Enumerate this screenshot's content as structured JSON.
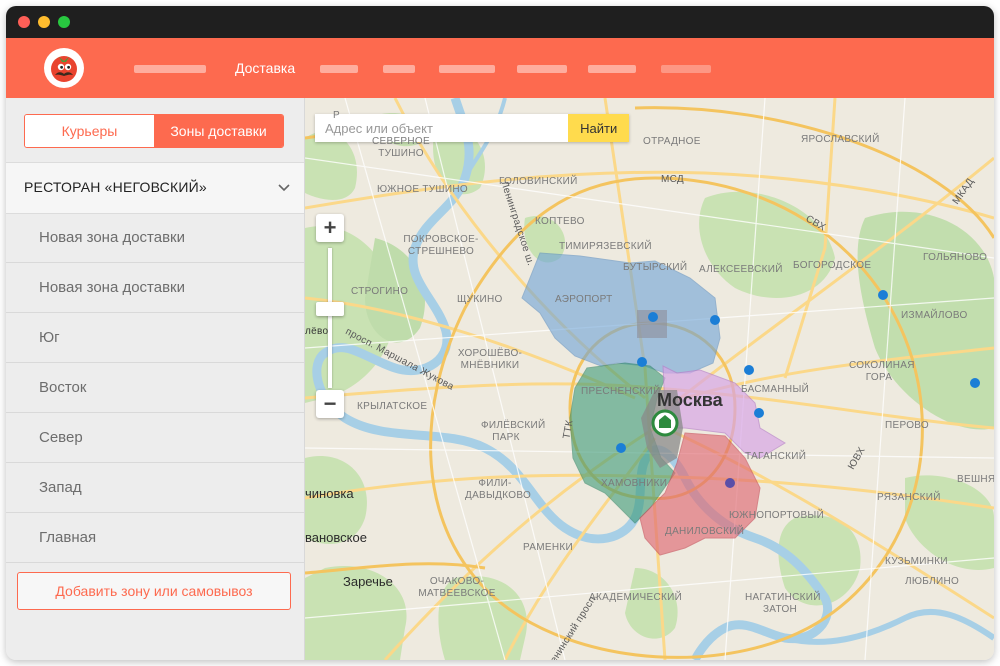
{
  "header": {
    "active_nav": "Доставка"
  },
  "sidebar": {
    "tabs": [
      {
        "label": "Курьеры"
      },
      {
        "label": "Зоны доставки"
      }
    ],
    "restaurant": "РЕСТОРАН «НЕГОВСКИЙ»",
    "zones": [
      {
        "label": "Новая зона доставки"
      },
      {
        "label": "Новая зона доставки"
      },
      {
        "label": "Юг"
      },
      {
        "label": "Восток"
      },
      {
        "label": "Север"
      },
      {
        "label": "Запад"
      },
      {
        "label": "Главная"
      }
    ],
    "add_button": "Добавить зону или самовывоз"
  },
  "map": {
    "search": {
      "placeholder": "Адрес или объект",
      "button": "Найти"
    },
    "zoom_in": "+",
    "zoom_out": "−",
    "city": "Москва",
    "labels": [
      "Р",
      "СЕВЕРНОЕ ТУШИНО",
      "ЮЖНОЕ ТУШИНО",
      "ГОЛОВИНСКИЙ",
      "КОПТЕВО",
      "ТИМИРЯЗЕВСКИЙ",
      "ОТРАДНОЕ",
      "ЯРОСЛАВСКИЙ",
      "ПОКРОВСКОЕ-СТРЕШНЕВО",
      "БУТЫРСКИЙ",
      "АЛЕКСЕЕВСКИЙ",
      "БОГОРОДСКОЕ",
      "ГОЛЬЯНОВО",
      "СТРОГИНО",
      "ЩУКИНО",
      "АЭРОПОРТ",
      "ИЗМАЙЛОВО",
      "ХОРОШЁВО-МНЁВНИКИ",
      "ПРЕСНЕНСКИЙ",
      "БАСМАННЫЙ",
      "СОКОЛИНАЯ ГОРА",
      "КРЫЛАТСКОЕ",
      "ФИЛЁВСКИЙ ПАРК",
      "ТАГАНСКИЙ",
      "ПЕРОВО",
      "ХАМОВНИКИ",
      "ФИЛИ-ДАВЫДКОВО",
      "ЮЖНОПОРТОВЫЙ",
      "ВЕШНЯКИ",
      "РЯЗАНСКИЙ",
      "ДАНИЛОВСКИЙ",
      "РАМЕНКИ",
      "КУЗЬМИНКИ",
      "ОЧАКОВО-МАТВЕЕВСКОЕ",
      "ЛЮБЛИНО",
      "АКАДЕМИЧЕСКИЙ",
      "НАГАТИНСКИЙ ЗАТОН",
      "ТТК",
      "МКАД",
      "СВХ",
      "МСД",
      "ЮВХ",
      "чиновка",
      "вановское",
      "Заречье",
      "лёво",
      "просп. Маршала Жукова",
      "Ленинградское ш.",
      "Ленинский просп."
    ]
  }
}
